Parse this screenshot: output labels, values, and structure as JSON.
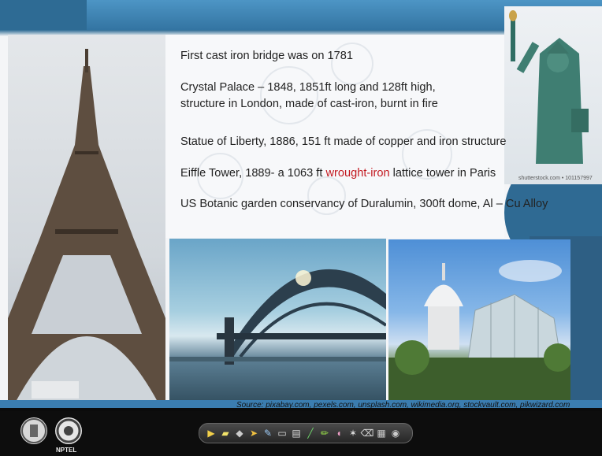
{
  "slide": {
    "bullets": [
      "First cast iron bridge was on 1781",
      "Crystal Palace – 1848, 1851ft long and 128ft high,",
      "structure in London, made of cast-iron, burnt in fire",
      "Statue of Liberty, 1886, 151 ft made of copper and iron structure",
      "Eiffle Tower, 1889- a 1063 ft",
      "wrought-iron",
      "lattice tower in Paris",
      "US Botanic garden conservancy of Duralumin, 300ft dome, Al – Cu Alloy"
    ],
    "image_credit": "shutterstock.com • 101157997",
    "source": "Source: pixabay.com, pexels.com, unsplash.com, wikimedia.org, stockvault.com, pikwizard.com",
    "highlight_color": "#c2181f"
  },
  "footer": {
    "logo_text": "NPTEL"
  },
  "toolbar": {
    "tools": [
      "play-icon",
      "highlighter-icon",
      "eraser-icon",
      "pointer-icon",
      "pen-icon",
      "shape-icon",
      "text-icon",
      "pen-thin-icon",
      "pen-green-icon",
      "marker-icon",
      "laser-icon",
      "clear-icon",
      "board-icon",
      "record-icon"
    ]
  }
}
